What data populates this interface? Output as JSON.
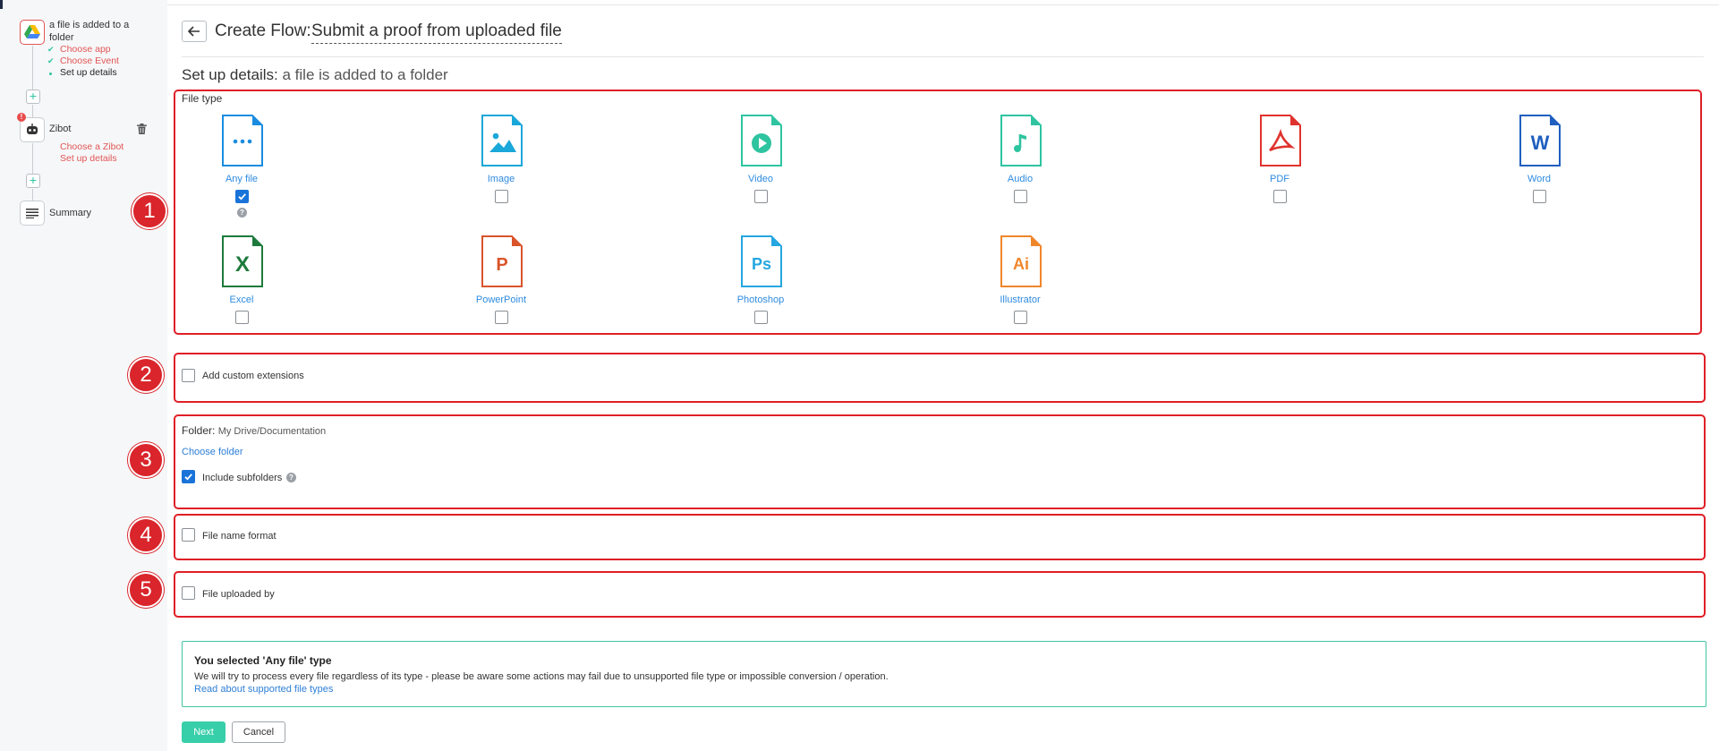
{
  "sidebar": {
    "trigger": {
      "title": "a file is added to a folder",
      "icon": "google-drive-icon",
      "substeps": [
        "Choose app",
        "Choose Event",
        "Set up details"
      ]
    },
    "action": {
      "title": "Zibot",
      "icon": "robot-icon",
      "substeps": [
        "Choose a Zibot",
        "Set up details"
      ]
    },
    "summary": {
      "title": "Summary",
      "icon": "list-icon"
    }
  },
  "header": {
    "title_prefix": "Create Flow:",
    "flow_name": "Submit a proof from uploaded file",
    "setup_label": "Set up details:",
    "setup_subject": "a file is added to a folder"
  },
  "file_type": {
    "label": "File type",
    "items": [
      {
        "name": "Any file",
        "icon": "any-file-icon",
        "checked": true,
        "color": "#1a8ce0"
      },
      {
        "name": "Image",
        "icon": "image-file-icon",
        "checked": false,
        "color": "#1aa7d9"
      },
      {
        "name": "Video",
        "icon": "video-file-icon",
        "checked": false,
        "color": "#2ec4a0"
      },
      {
        "name": "Audio",
        "icon": "audio-file-icon",
        "checked": false,
        "color": "#2ec4a0"
      },
      {
        "name": "PDF",
        "icon": "pdf-file-icon",
        "checked": false,
        "color": "#e0322d"
      },
      {
        "name": "Word",
        "icon": "word-file-icon",
        "checked": false,
        "color": "#1f5fbf"
      },
      {
        "name": "Excel",
        "icon": "excel-file-icon",
        "checked": false,
        "color": "#1e7a3c"
      },
      {
        "name": "PowerPoint",
        "icon": "powerpoint-file-icon",
        "checked": false,
        "color": "#d9542b"
      },
      {
        "name": "Photoshop",
        "icon": "photoshop-file-icon",
        "checked": false,
        "color": "#25a6e0"
      },
      {
        "name": "Illustrator",
        "icon": "illustrator-file-icon",
        "checked": false,
        "color": "#f0862a"
      }
    ]
  },
  "custom_extensions": {
    "label": "Add custom extensions",
    "checked": false
  },
  "folder": {
    "label": "Folder:",
    "path": "My Drive/Documentation",
    "choose_link": "Choose folder",
    "include_subfolders_label": "Include subfolders",
    "include_subfolders": true
  },
  "file_name_format": {
    "label": "File name format",
    "checked": false
  },
  "file_uploaded_by": {
    "label": "File uploaded by",
    "checked": false
  },
  "markers": [
    "1",
    "2",
    "3",
    "4",
    "5"
  ],
  "info": {
    "title": "You selected 'Any file' type",
    "text": "We will try to process every file regardless of its type - please be aware some actions may fail due to unsupported file type or impossible conversion / operation.",
    "link": "Read about supported file types"
  },
  "buttons": {
    "next": "Next",
    "cancel": "Cancel"
  },
  "colors": {
    "accent": "#2ec4a0",
    "alert": "#e01f26",
    "link": "#2e7fd6",
    "checkbox": "#1a73d9"
  }
}
